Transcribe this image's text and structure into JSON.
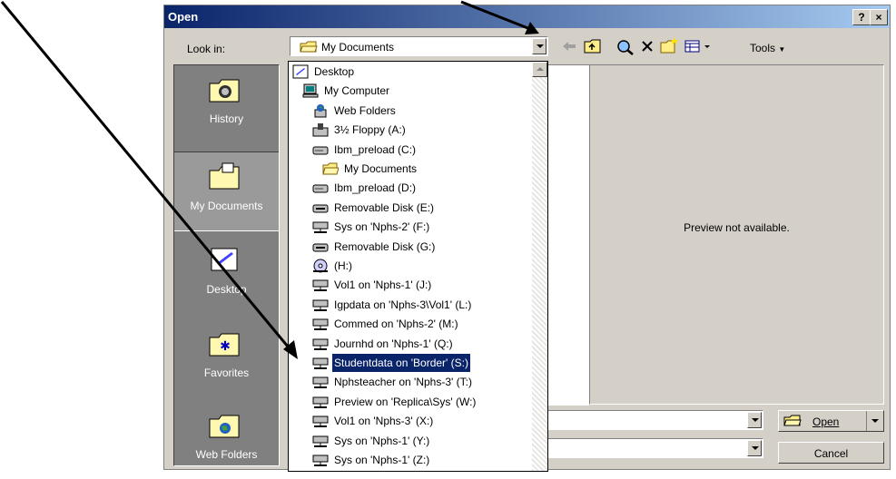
{
  "window": {
    "title": "Open",
    "help_btn": "?",
    "close_btn": "×"
  },
  "lookin": {
    "label": "Look in:",
    "value": "My Documents"
  },
  "toolbar": {
    "tools_label": "Tools"
  },
  "places": [
    {
      "label": "History",
      "icon": "history-folder-icon"
    },
    {
      "label": "My Documents",
      "icon": "my-documents-folder-icon"
    },
    {
      "label": "Desktop",
      "icon": "desktop-icon"
    },
    {
      "label": "Favorites",
      "icon": "favorites-folder-icon"
    },
    {
      "label": "Web Folders",
      "icon": "web-folders-icon"
    }
  ],
  "dropdown_items": [
    {
      "label": "Desktop",
      "icon": "desktop-icon",
      "indent": 0
    },
    {
      "label": "My Computer",
      "icon": "computer-icon",
      "indent": 1
    },
    {
      "label": "Web Folders",
      "icon": "web-folders-icon",
      "indent": 2
    },
    {
      "label": "3½ Floppy (A:)",
      "icon": "floppy-drive-icon",
      "indent": 2
    },
    {
      "label": "Ibm_preload (C:)",
      "icon": "hard-drive-icon",
      "indent": 2
    },
    {
      "label": "My Documents",
      "icon": "folder-open-icon",
      "indent": 3
    },
    {
      "label": "Ibm_preload (D:)",
      "icon": "hard-drive-icon",
      "indent": 2
    },
    {
      "label": "Removable Disk (E:)",
      "icon": "removable-disk-icon",
      "indent": 2
    },
    {
      "label": "Sys on 'Nphs-2' (F:)",
      "icon": "network-drive-icon",
      "indent": 2
    },
    {
      "label": "Removable Disk (G:)",
      "icon": "removable-disk-icon",
      "indent": 2
    },
    {
      "label": "(H:)",
      "icon": "cd-drive-icon",
      "indent": 2
    },
    {
      "label": "Vol1 on 'Nphs-1' (J:)",
      "icon": "network-drive-icon",
      "indent": 2
    },
    {
      "label": "Igpdata on 'Nphs-3\\Vol1' (L:)",
      "icon": "network-drive-icon",
      "indent": 2
    },
    {
      "label": "Commed on 'Nphs-2' (M:)",
      "icon": "network-drive-icon",
      "indent": 2
    },
    {
      "label": "Journhd on 'Nphs-1' (Q:)",
      "icon": "network-drive-icon",
      "indent": 2
    },
    {
      "label": "Studentdata on 'Border' (S:)",
      "icon": "network-drive-icon",
      "indent": 2,
      "selected": true
    },
    {
      "label": "Nphsteacher on 'Nphs-3' (T:)",
      "icon": "network-drive-icon",
      "indent": 2
    },
    {
      "label": "Preview on 'Replica\\Sys' (W:)",
      "icon": "network-drive-icon",
      "indent": 2
    },
    {
      "label": "Vol1 on 'Nphs-3' (X:)",
      "icon": "network-drive-icon",
      "indent": 2
    },
    {
      "label": "Sys on 'Nphs-1' (Y:)",
      "icon": "network-drive-icon",
      "indent": 2
    },
    {
      "label": "Sys on 'Nphs-1' (Z:)",
      "icon": "network-drive-icon",
      "indent": 2
    }
  ],
  "preview": {
    "text": "Preview not available."
  },
  "buttons": {
    "open": "Open",
    "cancel": "Cancel"
  },
  "colors": {
    "title_start": "#0a246a",
    "title_end": "#a6caf0",
    "selection": "#0a246a",
    "face": "#d4d0c8"
  }
}
